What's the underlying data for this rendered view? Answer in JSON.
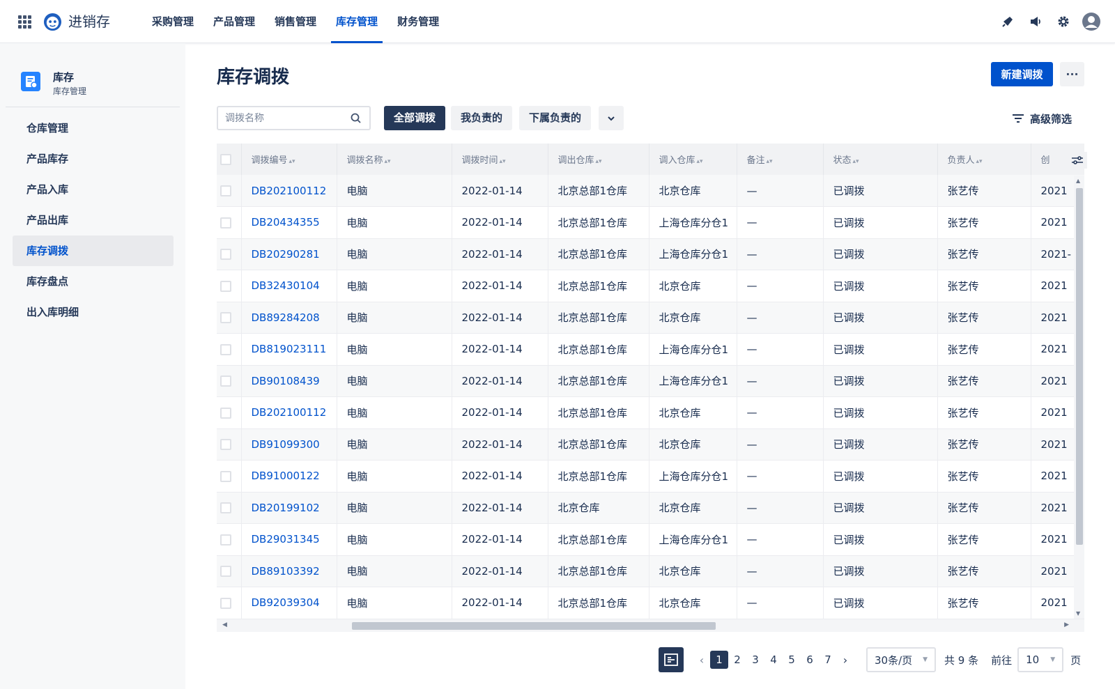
{
  "header": {
    "app_name": "进销存",
    "nav": [
      {
        "label": "采购管理",
        "active": false
      },
      {
        "label": "产品管理",
        "active": false
      },
      {
        "label": "销售管理",
        "active": false
      },
      {
        "label": "库存管理",
        "active": true
      },
      {
        "label": "财务管理",
        "active": false
      }
    ],
    "icons": [
      "notification-icon",
      "announcement-icon",
      "gear-icon",
      "avatar-icon"
    ]
  },
  "sidebar": {
    "title": "库存",
    "subtitle": "库存管理",
    "items": [
      {
        "label": "仓库管理",
        "active": false
      },
      {
        "label": "产品库存",
        "active": false
      },
      {
        "label": "产品入库",
        "active": false
      },
      {
        "label": "产品出库",
        "active": false
      },
      {
        "label": "库存调拨",
        "active": true
      },
      {
        "label": "库存盘点",
        "active": false
      },
      {
        "label": "出入库明细",
        "active": false
      }
    ]
  },
  "main": {
    "title": "库存调拨",
    "new_button": "新建调拨",
    "more_label": "···",
    "search": {
      "placeholder": "调拨名称",
      "value": ""
    },
    "tabs": [
      "全部调拨",
      "我负责的",
      "下属负责的"
    ],
    "advanced_filter": "高级筛选"
  },
  "table": {
    "columns": [
      "调拨编号",
      "调拨名称",
      "调拨时间",
      "调出仓库",
      "调入仓库",
      "备注",
      "状态",
      "负责人",
      "创"
    ],
    "rows": [
      [
        "DB202100112",
        "电脑",
        "2022-01-14",
        "北京总部1仓库",
        "北京仓库",
        "—",
        "已调拨",
        "张艺传",
        "2021"
      ],
      [
        "DB20434355",
        "电脑",
        "2022-01-14",
        "北京总部1仓库",
        "上海仓库分仓1",
        "—",
        "已调拨",
        "张艺传",
        "2021"
      ],
      [
        "DB20290281",
        "电脑",
        "2022-01-14",
        "北京总部1仓库",
        "上海仓库分仓1",
        "—",
        "已调拨",
        "张艺传",
        "2021-"
      ],
      [
        "DB32430104",
        "电脑",
        "2022-01-14",
        "北京总部1仓库",
        "北京仓库",
        "—",
        "已调拨",
        "张艺传",
        "2021"
      ],
      [
        "DB89284208",
        "电脑",
        "2022-01-14",
        "北京总部1仓库",
        "北京仓库",
        "—",
        "已调拨",
        "张艺传",
        "2021"
      ],
      [
        "DB819023111",
        "电脑",
        "2022-01-14",
        "北京总部1仓库",
        "上海仓库分仓1",
        "—",
        "已调拨",
        "张艺传",
        "2021"
      ],
      [
        "DB90108439",
        "电脑",
        "2022-01-14",
        "北京总部1仓库",
        "上海仓库分仓1",
        "—",
        "已调拨",
        "张艺传",
        "2021"
      ],
      [
        "DB202100112",
        "电脑",
        "2022-01-14",
        "北京总部1仓库",
        "北京仓库",
        "—",
        "已调拨",
        "张艺传",
        "2021"
      ],
      [
        "DB91099300",
        "电脑",
        "2022-01-14",
        "北京总部1仓库",
        "北京仓库",
        "—",
        "已调拨",
        "张艺传",
        "2021"
      ],
      [
        "DB91000122",
        "电脑",
        "2022-01-14",
        "北京总部1仓库",
        "上海仓库分仓1",
        "—",
        "已调拨",
        "张艺传",
        "2021"
      ],
      [
        "DB20199102",
        "电脑",
        "2022-01-14",
        "北京仓库",
        "北京仓库",
        "—",
        "已调拨",
        "张艺传",
        "2021"
      ],
      [
        "DB29031345",
        "电脑",
        "2022-01-14",
        "北京总部1仓库",
        "上海仓库分仓1",
        "—",
        "已调拨",
        "张艺传",
        "2021"
      ],
      [
        "DB89103392",
        "电脑",
        "2022-01-14",
        "北京总部1仓库",
        "北京仓库",
        "—",
        "已调拨",
        "张艺传",
        "2021"
      ],
      [
        "DB92039304",
        "电脑",
        "2022-01-14",
        "北京总部1仓库",
        "北京仓库",
        "—",
        "已调拨",
        "张艺传",
        "2021"
      ]
    ]
  },
  "pagination": {
    "pages": [
      "1",
      "2",
      "3",
      "4",
      "5",
      "6",
      "7"
    ],
    "current": "1",
    "page_size": "30条/页",
    "total": "共 9 条",
    "goto_label": "前往",
    "goto_value": "10",
    "page_suffix": "页"
  },
  "colors": {
    "accent": "#0052cc",
    "dark": "#253858",
    "sidebar_bg": "#f7f8f9"
  }
}
